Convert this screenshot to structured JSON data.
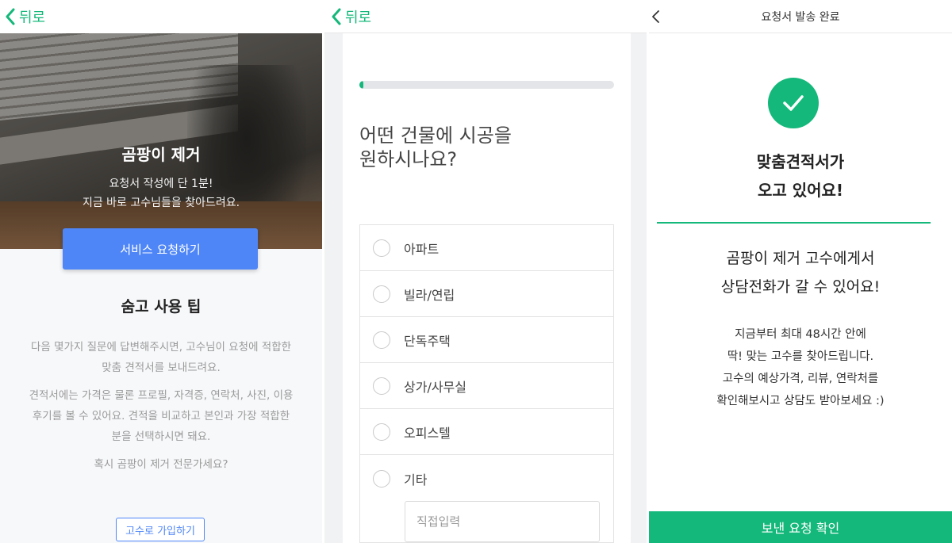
{
  "colors": {
    "accent_green": "#14b87a",
    "accent_blue": "#4f86f7",
    "muted_text": "#9a9a9a"
  },
  "panel1": {
    "back_label": "뒤로",
    "hero": {
      "title": "곰팡이 제거",
      "subtitle_line1": "요청서 작성에 단 1분!",
      "subtitle_line2": "지금 바로 고수님들을 찾아드려요."
    },
    "cta_label": "서비스 요청하기",
    "tips": {
      "title": "숨고 사용 팁",
      "para1_line1": "다음 몇가지 질문에 답변해주시면, 고수님이 요청에 적합한",
      "para1_line2": "맞춤 견적서를 보내드려요.",
      "para2_line1": "견적서에는 가격은 물론 프로필, 자격증, 연락처, 사진, 이용",
      "para2_line2": "후기를 볼 수 있어요. 견적을 비교하고 본인과 가장 적합한",
      "para2_line3": "분을 선택하시면 돼요.",
      "para3": "혹시 곰팡이 제거 전문가세요?"
    },
    "signup_label": "고수로 가입하기"
  },
  "panel2": {
    "back_label": "뒤로",
    "progress_fraction": 0.01,
    "question_line1": "어떤 건물에 시공을",
    "question_line2": "원하시나요?",
    "options": [
      "아파트",
      "빌라/연립",
      "단독주택",
      "상가/사무실",
      "오피스텔",
      "기타"
    ],
    "other_placeholder": "직접입력"
  },
  "panel3": {
    "title": "요청서 발송 완료",
    "check_icon": "checkmark-icon",
    "headline_line1": "맞춤견적서가",
    "headline_line2": "오고 있어요!",
    "sub_line1": "곰팡이 제거 고수에게서",
    "sub_line2": "상담전화가 갈 수 있어요!",
    "body_line1": "지금부터 최대 48시간 안에",
    "body_line2": "딱! 맞는 고수를 찾아드립니다.",
    "body_line3": "고수의 예상가격, 리뷰, 연락처를",
    "body_line4": "확인해보시고 상담도 받아보세요 :)",
    "confirm_label": "보낸 요청 확인"
  }
}
